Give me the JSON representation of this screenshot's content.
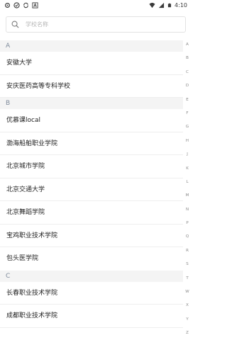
{
  "status_bar": {
    "time": "4:10",
    "left_icons": [
      "settings-gear-icon",
      "shield-icon",
      "sync-icon",
      "font-a-icon"
    ],
    "right_icons": [
      "wifi-icon",
      "signal-icon",
      "battery-icon"
    ]
  },
  "search": {
    "placeholder": "学校名称",
    "value": ""
  },
  "sections": [
    {
      "letter": "A",
      "items": [
        "安徽大学",
        "安庆医药高等专科学校"
      ]
    },
    {
      "letter": "B",
      "items": [
        "优慕课local",
        "渤海船舶职业学院",
        "北京城市学院",
        "北京交通大学",
        "北京舞蹈学院",
        "宝鸡职业技术学院",
        "包头医学院"
      ]
    },
    {
      "letter": "C",
      "items": [
        "长春职业技术学院",
        "成都职业技术学院"
      ]
    }
  ],
  "index_bar": [
    "A",
    "B",
    "C",
    "D",
    "E",
    "F",
    "G",
    "H",
    "J",
    "K",
    "L",
    "M",
    "N",
    "P",
    "Q",
    "R",
    "S",
    "T",
    "W",
    "X",
    "Y",
    "Z"
  ],
  "colors": {
    "section_bg": "#f4f4f4",
    "section_text": "#7f8b9b",
    "item_text": "#222222",
    "divider": "#eeeeee",
    "index_text": "#8a8a8a"
  }
}
